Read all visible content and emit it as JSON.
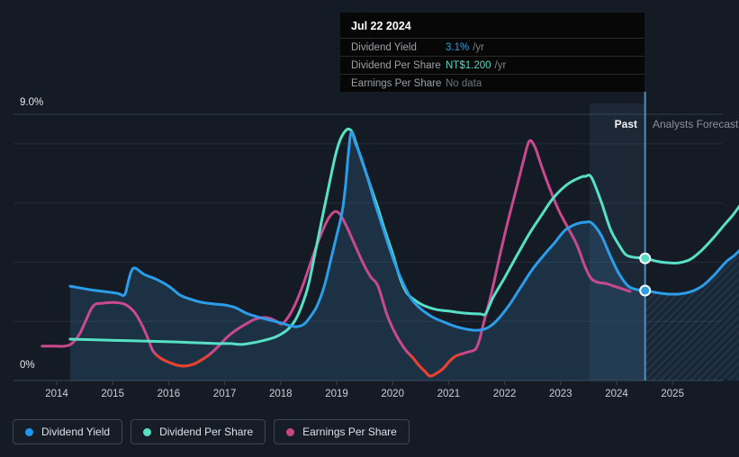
{
  "tooltip": {
    "date": "Jul 22 2024",
    "rows": [
      {
        "label": "Dividend Yield",
        "value": "3.1%",
        "suffix": "/yr",
        "value_color": "#2D9FE8"
      },
      {
        "label": "Dividend Per Share",
        "value": "NT$1.200",
        "suffix": "/yr",
        "value_color": "#4FDCC3"
      },
      {
        "label": "Earnings Per Share",
        "value": "No data",
        "suffix": "",
        "value_color": "#6E757E"
      }
    ]
  },
  "chart": {
    "past_label": "Past",
    "forecast_label": "Analysts Forecast",
    "y_max_label": "9.0%",
    "y_zero_label": "0%"
  },
  "legend": [
    {
      "label": "Dividend Yield",
      "color": "#2196F3"
    },
    {
      "label": "Dividend Per Share",
      "color": "#58E0C7"
    },
    {
      "label": "Earnings Per Share",
      "color": "#C6487F"
    }
  ],
  "colors": {
    "background": "#151B24",
    "grid": "#242D39",
    "grid_top": "#313B49",
    "axis": "#3A4452",
    "today_line": "#4A8FC0",
    "past_area": "rgba(52,110,160,0.27)",
    "past_band": "rgba(96,160,220,0.10)",
    "forecast_area": "rgba(46,105,155,0.12)",
    "forecast_stripe": "rgba(90,150,200,0.12)"
  },
  "chart_data": {
    "type": "line",
    "x_axis": {
      "unit": "year",
      "tick_years": [
        2014,
        2015,
        2016,
        2017,
        2018,
        2019,
        2020,
        2021,
        2022,
        2023,
        2024,
        2025
      ],
      "range": [
        2013.7,
        2026.2
      ]
    },
    "y_axis": {
      "label_top": "9.0%",
      "label_bottom": "0%",
      "min_pct": 0,
      "max_pct": 9,
      "grid_pct": [
        9,
        8,
        6,
        4,
        2
      ]
    },
    "past_band_start_year": 2023.52,
    "today_year": 2024.51,
    "today_tooltip_date": "Jul 22 2024",
    "eps_negative_threshold_pct": 0.88,
    "points_unit": "percent_on_yield_axis",
    "series": [
      {
        "name": "Dividend Yield",
        "color": "#2B9DE9",
        "today_value": "3.1% /yr",
        "points": [
          [
            2014.24,
            3.19
          ],
          [
            2014.59,
            3.07
          ],
          [
            2014.84,
            3.01
          ],
          [
            2015.08,
            2.95
          ],
          [
            2015.21,
            2.89
          ],
          [
            2015.27,
            3.28
          ],
          [
            2015.33,
            3.68
          ],
          [
            2015.4,
            3.8
          ],
          [
            2015.56,
            3.59
          ],
          [
            2015.77,
            3.43
          ],
          [
            2016.0,
            3.19
          ],
          [
            2016.2,
            2.89
          ],
          [
            2016.36,
            2.77
          ],
          [
            2016.6,
            2.64
          ],
          [
            2016.85,
            2.58
          ],
          [
            2017.01,
            2.55
          ],
          [
            2017.2,
            2.46
          ],
          [
            2017.38,
            2.28
          ],
          [
            2017.57,
            2.16
          ],
          [
            2017.81,
            2.04
          ],
          [
            2018.0,
            1.95
          ],
          [
            2018.18,
            1.85
          ],
          [
            2018.29,
            1.82
          ],
          [
            2018.42,
            1.91
          ],
          [
            2018.53,
            2.16
          ],
          [
            2018.65,
            2.52
          ],
          [
            2018.78,
            3.19
          ],
          [
            2018.89,
            4.04
          ],
          [
            2019.0,
            4.9
          ],
          [
            2019.1,
            5.72
          ],
          [
            2019.16,
            6.63
          ],
          [
            2019.21,
            7.69
          ],
          [
            2019.26,
            8.39
          ],
          [
            2019.34,
            8.0
          ],
          [
            2019.42,
            7.63
          ],
          [
            2019.55,
            6.87
          ],
          [
            2019.69,
            5.96
          ],
          [
            2019.82,
            5.2
          ],
          [
            2019.93,
            4.56
          ],
          [
            2020.06,
            3.86
          ],
          [
            2020.19,
            3.28
          ],
          [
            2020.32,
            2.8
          ],
          [
            2020.48,
            2.46
          ],
          [
            2020.7,
            2.16
          ],
          [
            2020.95,
            1.95
          ],
          [
            2021.19,
            1.79
          ],
          [
            2021.46,
            1.7
          ],
          [
            2021.67,
            1.76
          ],
          [
            2021.85,
            2.01
          ],
          [
            2022.07,
            2.52
          ],
          [
            2022.28,
            3.13
          ],
          [
            2022.49,
            3.74
          ],
          [
            2022.71,
            4.26
          ],
          [
            2022.89,
            4.65
          ],
          [
            2023.08,
            5.08
          ],
          [
            2023.28,
            5.29
          ],
          [
            2023.44,
            5.35
          ],
          [
            2023.56,
            5.32
          ],
          [
            2023.73,
            4.89
          ],
          [
            2023.89,
            4.2
          ],
          [
            2024.05,
            3.59
          ],
          [
            2024.21,
            3.19
          ],
          [
            2024.37,
            3.07
          ],
          [
            2024.51,
            3.04
          ],
          [
            2024.75,
            2.96
          ],
          [
            2024.95,
            2.92
          ],
          [
            2025.15,
            2.93
          ],
          [
            2025.35,
            3.02
          ],
          [
            2025.55,
            3.22
          ],
          [
            2025.75,
            3.58
          ],
          [
            2025.95,
            4.0
          ],
          [
            2026.1,
            4.22
          ],
          [
            2026.22,
            4.44
          ]
        ]
      },
      {
        "name": "Dividend Per Share",
        "color": "#58E0C7",
        "today_value": "NT$1.200 /yr",
        "points": [
          [
            2014.24,
            1.4
          ],
          [
            2014.76,
            1.37
          ],
          [
            2015.4,
            1.34
          ],
          [
            2016.0,
            1.31
          ],
          [
            2016.44,
            1.28
          ],
          [
            2016.85,
            1.25
          ],
          [
            2017.09,
            1.25
          ],
          [
            2017.3,
            1.22
          ],
          [
            2017.52,
            1.28
          ],
          [
            2017.73,
            1.37
          ],
          [
            2017.89,
            1.46
          ],
          [
            2018.02,
            1.58
          ],
          [
            2018.13,
            1.73
          ],
          [
            2018.26,
            2.04
          ],
          [
            2018.37,
            2.49
          ],
          [
            2018.49,
            3.19
          ],
          [
            2018.61,
            4.26
          ],
          [
            2018.74,
            5.47
          ],
          [
            2018.86,
            6.57
          ],
          [
            2018.97,
            7.54
          ],
          [
            2019.06,
            8.12
          ],
          [
            2019.18,
            8.48
          ],
          [
            2019.27,
            8.42
          ],
          [
            2019.34,
            8.06
          ],
          [
            2019.47,
            7.33
          ],
          [
            2019.61,
            6.54
          ],
          [
            2019.74,
            5.81
          ],
          [
            2019.87,
            5.02
          ],
          [
            2020.0,
            4.29
          ],
          [
            2020.11,
            3.59
          ],
          [
            2020.19,
            3.19
          ],
          [
            2020.27,
            2.92
          ],
          [
            2020.38,
            2.74
          ],
          [
            2020.54,
            2.55
          ],
          [
            2020.78,
            2.4
          ],
          [
            2021.03,
            2.34
          ],
          [
            2021.27,
            2.28
          ],
          [
            2021.56,
            2.25
          ],
          [
            2021.66,
            2.26
          ],
          [
            2021.8,
            2.83
          ],
          [
            2021.99,
            3.44
          ],
          [
            2022.23,
            4.26
          ],
          [
            2022.44,
            4.96
          ],
          [
            2022.65,
            5.56
          ],
          [
            2022.87,
            6.17
          ],
          [
            2023.12,
            6.63
          ],
          [
            2023.36,
            6.87
          ],
          [
            2023.44,
            6.9
          ],
          [
            2023.55,
            6.87
          ],
          [
            2023.73,
            6.02
          ],
          [
            2023.89,
            5.11
          ],
          [
            2024.05,
            4.56
          ],
          [
            2024.16,
            4.26
          ],
          [
            2024.29,
            4.17
          ],
          [
            2024.51,
            4.13
          ],
          [
            2024.72,
            4.03
          ],
          [
            2024.92,
            3.98
          ],
          [
            2025.12,
            3.98
          ],
          [
            2025.32,
            4.1
          ],
          [
            2025.52,
            4.4
          ],
          [
            2025.72,
            4.8
          ],
          [
            2025.92,
            5.25
          ],
          [
            2026.08,
            5.6
          ],
          [
            2026.22,
            5.96
          ]
        ]
      },
      {
        "name": "Earnings Per Share",
        "color": "#C9498F",
        "negative_color": "#E8422D",
        "today_value": "No data",
        "points": [
          [
            2013.74,
            1.16
          ],
          [
            2013.95,
            1.16
          ],
          [
            2014.14,
            1.16
          ],
          [
            2014.27,
            1.25
          ],
          [
            2014.4,
            1.55
          ],
          [
            2014.51,
            1.98
          ],
          [
            2014.61,
            2.4
          ],
          [
            2014.69,
            2.58
          ],
          [
            2014.79,
            2.61
          ],
          [
            2015.0,
            2.64
          ],
          [
            2015.16,
            2.61
          ],
          [
            2015.27,
            2.52
          ],
          [
            2015.4,
            2.28
          ],
          [
            2015.53,
            1.85
          ],
          [
            2015.64,
            1.37
          ],
          [
            2015.72,
            1.0
          ],
          [
            2015.85,
            0.76
          ],
          [
            2016.01,
            0.61
          ],
          [
            2016.15,
            0.52
          ],
          [
            2016.28,
            0.49
          ],
          [
            2016.44,
            0.55
          ],
          [
            2016.59,
            0.7
          ],
          [
            2016.73,
            0.88
          ],
          [
            2016.89,
            1.16
          ],
          [
            2017.04,
            1.46
          ],
          [
            2017.2,
            1.7
          ],
          [
            2017.38,
            1.91
          ],
          [
            2017.54,
            2.07
          ],
          [
            2017.7,
            2.13
          ],
          [
            2017.81,
            2.1
          ],
          [
            2017.92,
            2.01
          ],
          [
            2018.02,
            1.91
          ],
          [
            2018.13,
            2.13
          ],
          [
            2018.26,
            2.58
          ],
          [
            2018.39,
            3.19
          ],
          [
            2018.52,
            3.89
          ],
          [
            2018.65,
            4.59
          ],
          [
            2018.78,
            5.2
          ],
          [
            2018.87,
            5.53
          ],
          [
            2018.97,
            5.71
          ],
          [
            2019.06,
            5.62
          ],
          [
            2019.18,
            5.2
          ],
          [
            2019.31,
            4.65
          ],
          [
            2019.47,
            3.98
          ],
          [
            2019.61,
            3.5
          ],
          [
            2019.74,
            3.19
          ],
          [
            2019.9,
            2.22
          ],
          [
            2020.06,
            1.55
          ],
          [
            2020.22,
            1.06
          ],
          [
            2020.35,
            0.79
          ],
          [
            2020.48,
            0.49
          ],
          [
            2020.58,
            0.3
          ],
          [
            2020.67,
            0.15
          ],
          [
            2020.78,
            0.24
          ],
          [
            2020.9,
            0.4
          ],
          [
            2021.01,
            0.64
          ],
          [
            2021.12,
            0.82
          ],
          [
            2021.25,
            0.91
          ],
          [
            2021.36,
            0.97
          ],
          [
            2021.48,
            1.06
          ],
          [
            2021.55,
            1.37
          ],
          [
            2021.62,
            1.91
          ],
          [
            2021.75,
            2.83
          ],
          [
            2021.93,
            4.35
          ],
          [
            2022.07,
            5.47
          ],
          [
            2022.23,
            6.63
          ],
          [
            2022.34,
            7.45
          ],
          [
            2022.44,
            8.09
          ],
          [
            2022.54,
            7.9
          ],
          [
            2022.65,
            7.3
          ],
          [
            2022.79,
            6.57
          ],
          [
            2022.96,
            5.78
          ],
          [
            2023.12,
            5.2
          ],
          [
            2023.29,
            4.59
          ],
          [
            2023.44,
            3.83
          ],
          [
            2023.55,
            3.44
          ],
          [
            2023.68,
            3.31
          ],
          [
            2023.81,
            3.28
          ],
          [
            2023.95,
            3.19
          ],
          [
            2024.1,
            3.1
          ],
          [
            2024.24,
            3.01
          ]
        ]
      }
    ],
    "markers": [
      {
        "series": 0,
        "year": 2024.51,
        "pct": 3.04
      },
      {
        "series": 1,
        "year": 2024.51,
        "pct": 4.13
      }
    ]
  }
}
